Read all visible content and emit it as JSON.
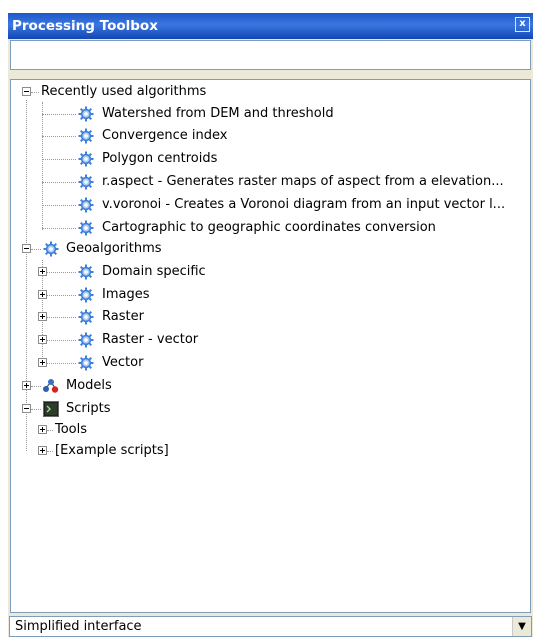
{
  "panel": {
    "title": "Processing Toolbox",
    "close_label": "x"
  },
  "search": {
    "value": "",
    "placeholder": ""
  },
  "tree": {
    "recent": {
      "label": "Recently used algorithms",
      "items": [
        "Watershed from DEM and threshold",
        "Convergence index",
        "Polygon centroids",
        "r.aspect - Generates raster maps of aspect from a elevation...",
        "v.voronoi - Creates a Voronoi diagram from an input vector l...",
        "Cartographic to geographic coordinates conversion"
      ]
    },
    "geo": {
      "label": "Geoalgorithms",
      "items": [
        "Domain specific",
        "Images",
        "Raster",
        "Raster - vector",
        "Vector"
      ]
    },
    "models": {
      "label": "Models"
    },
    "scripts": {
      "label": "Scripts",
      "items": [
        "Tools",
        "[Example scripts]"
      ]
    }
  },
  "bottom": {
    "mode": "Simplified interface"
  },
  "icons": {
    "gear": "gear-icon",
    "models": "models-icon",
    "scripts": "script-icon"
  },
  "colors": {
    "accent": "#2b63d6",
    "gear": "#3f7fd8",
    "panel": "#ece9d8"
  }
}
